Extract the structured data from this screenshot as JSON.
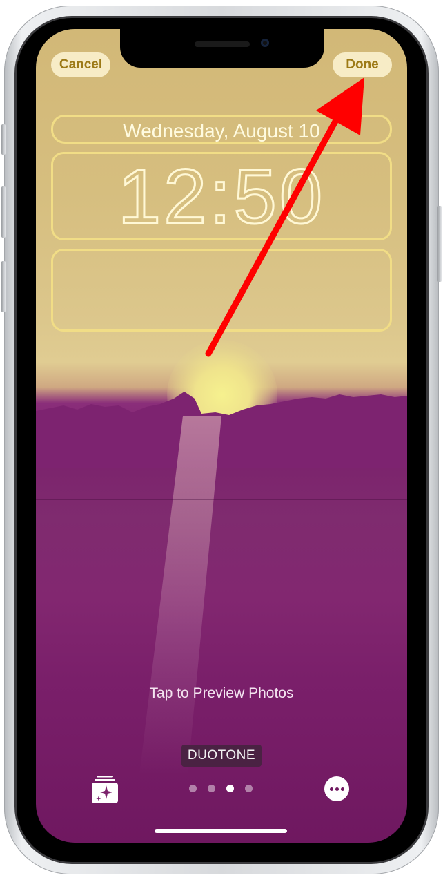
{
  "header": {
    "cancel_label": "Cancel",
    "done_label": "Done"
  },
  "lock_screen": {
    "date": "Wednesday, August 10",
    "time": "12:50"
  },
  "wallpaper": {
    "hint": "Tap to Preview Photos",
    "filter_name": "DUOTONE",
    "page_count": 4,
    "active_page": 3
  },
  "colors": {
    "duotone_light": "#d6be7f",
    "duotone_dark": "#7b226c",
    "button_text": "#9d7a16",
    "annotation_arrow": "#ff0000"
  },
  "icons": {
    "gallery": "photo-stack-sparkle-icon",
    "more": "ellipsis-circle-icon"
  },
  "annotation": {
    "type": "arrow",
    "points_to": "done-button"
  }
}
